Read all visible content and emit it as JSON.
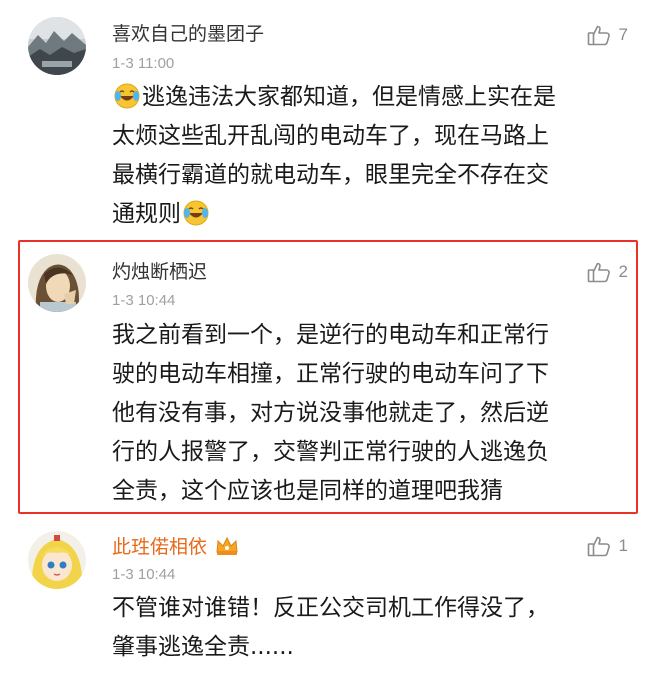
{
  "comments": [
    {
      "username": "喜欢自己的墨团子",
      "timestamp": "1-3 11:00",
      "likes": "7",
      "avatar": "landscape-avatar",
      "lines": [
        {
          "emoji_before": "laughing-crying-emoji",
          "text": "逃逸违法大家都知道，但是情感上实在是"
        },
        {
          "text": "太烦这些乱开乱闯的电动车了，现在马路上"
        },
        {
          "text": "最横行霸道的就电动车，眼里完全不存在交"
        },
        {
          "text": "通规则",
          "emoji_after": "laughing-crying-emoji"
        }
      ]
    },
    {
      "username": "灼烛断栖迟",
      "timestamp": "1-3 10:44",
      "likes": "2",
      "avatar": "anime-portrait-avatar",
      "highlighted": true,
      "lines": [
        {
          "text": "我之前看到一个，是逆行的电动车和正常行"
        },
        {
          "text": "驶的电动车相撞，正常行驶的电动车问了下"
        },
        {
          "text": "他有没有事，对方说没事他就走了，然后逆"
        },
        {
          "text": "行的人报警了，交警判正常行驶的人逃逸负"
        },
        {
          "text": "全责，这个应该也是同样的道理吧我猜"
        }
      ]
    },
    {
      "username": "此珄偌相依",
      "timestamp": "1-3 10:44",
      "likes": "1",
      "avatar": "blonde-anime-girl-avatar",
      "badge": "crown-badge-icon",
      "username_color": "#e86a1c",
      "lines": [
        {
          "text": "不管谁对谁错！反正公交司机工作得没了，"
        },
        {
          "text": "肇事逃逸全责......"
        }
      ]
    }
  ],
  "colors": {
    "highlight_border": "#e8322a",
    "vip_username": "#e86a1c",
    "meta_text": "#a0a0a0"
  }
}
